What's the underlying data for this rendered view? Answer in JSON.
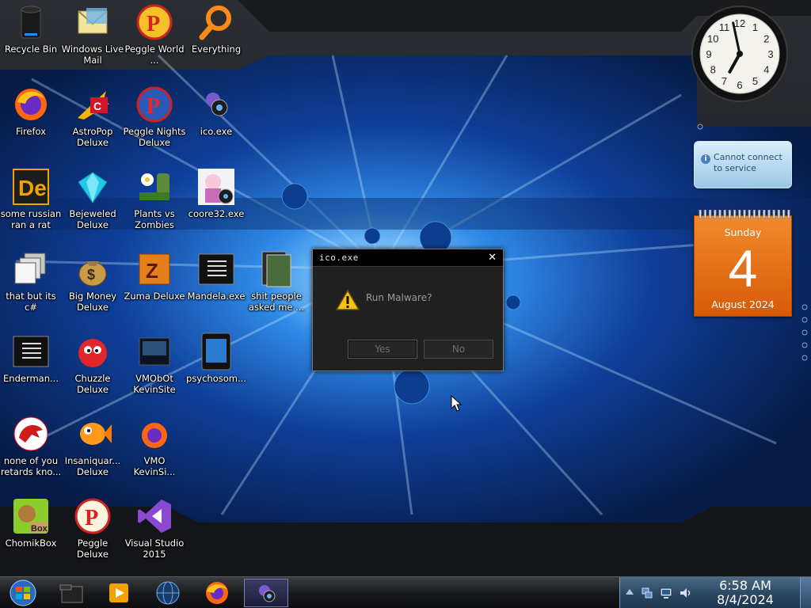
{
  "desktop": {
    "icons": [
      {
        "id": "recycle",
        "label": "Recycle Bin"
      },
      {
        "id": "wlmail",
        "label": "Windows Live Mail"
      },
      {
        "id": "peggle_world",
        "label": "Peggle World ..."
      },
      {
        "id": "everything",
        "label": "Everything"
      },
      {
        "id": "firefox",
        "label": "Firefox"
      },
      {
        "id": "astropop",
        "label": "AstroPop Deluxe"
      },
      {
        "id": "peggle_nights",
        "label": "Peggle Nights Deluxe"
      },
      {
        "id": "ico_exe",
        "label": "ico.exe"
      },
      {
        "id": "russian",
        "label": "some russian ran a rat"
      },
      {
        "id": "bejeweled",
        "label": "Bejeweled Deluxe"
      },
      {
        "id": "pvz",
        "label": "Plants vs Zombies"
      },
      {
        "id": "coore32",
        "label": "coore32.exe"
      },
      {
        "id": "thatbutits",
        "label": "that but its c#"
      },
      {
        "id": "bigmoney",
        "label": "Big Money Deluxe"
      },
      {
        "id": "zuma",
        "label": "Zuma Deluxe"
      },
      {
        "id": "mandela",
        "label": "Mandela.exe"
      },
      {
        "id": "shitpeople",
        "label": "shit people asked me ..."
      },
      {
        "id": "enderman",
        "label": "Enderman..."
      },
      {
        "id": "chuzzle",
        "label": "Chuzzle Deluxe"
      },
      {
        "id": "vm0b0t",
        "label": "VMObOt KevinSite"
      },
      {
        "id": "psychosom",
        "label": "psychosom..."
      },
      {
        "id": "noneofyou",
        "label": "none of you retards kno..."
      },
      {
        "id": "insaniquarium",
        "label": "Insaniquar... Deluxe"
      },
      {
        "id": "vmo",
        "label": "VMO KevinSi..."
      },
      {
        "id": "chomikbox",
        "label": "ChomikBox"
      },
      {
        "id": "peggle_deluxe",
        "label": "Peggle Deluxe"
      },
      {
        "id": "vs2015",
        "label": "Visual Studio 2015"
      }
    ]
  },
  "clock_gadget": {
    "hour": 6,
    "minute": 58
  },
  "weather_gadget": {
    "message": "Cannot connect to service"
  },
  "calendar_gadget": {
    "weekday": "Sunday",
    "day": "4",
    "month_year": "August 2024"
  },
  "dialog": {
    "title": "ico.exe",
    "close_glyph": "✕",
    "message": "Run Malware?",
    "yes_label": "Yes",
    "no_label": "No"
  },
  "taskbar": {
    "items": [
      {
        "id": "start",
        "icon": "windows-orb-icon"
      },
      {
        "id": "explorer",
        "icon": "folder-icon"
      },
      {
        "id": "media",
        "icon": "media-player-icon"
      },
      {
        "id": "ie",
        "icon": "globe-icon"
      },
      {
        "id": "firefox",
        "icon": "firefox-icon"
      },
      {
        "id": "ico_exe",
        "icon": "ico-exe-icon",
        "active": true
      }
    ],
    "tray": {
      "time": "6:58 AM",
      "date": "8/4/2024"
    }
  },
  "colors": {
    "accent": "#1e6fd0",
    "calendar": "#e4701a",
    "dialog_bg": "#202020"
  }
}
